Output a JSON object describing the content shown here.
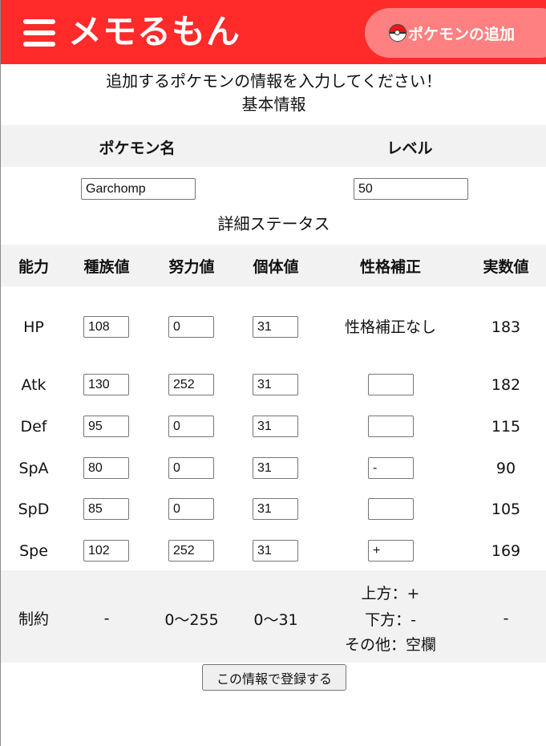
{
  "header": {
    "logo": "メモるもん",
    "add_button": "ポケモンの追加"
  },
  "intro": "追加するポケモンの情報を入力してください！",
  "basic_section": "基本情報",
  "basic": {
    "name_header": "ポケモン名",
    "level_header": "レベル",
    "name_value": "Garchomp",
    "level_value": "50"
  },
  "detail_section": "詳細ステータス",
  "stats_headers": [
    "能力",
    "種族値",
    "努力値",
    "個体値",
    "性格補正",
    "実数値"
  ],
  "stats": [
    {
      "label": "HP",
      "base": "108",
      "ev": "0",
      "iv": "31",
      "nature": "性格補正なし",
      "actual": "183"
    },
    {
      "label": "Atk",
      "base": "130",
      "ev": "252",
      "iv": "31",
      "nature": "",
      "actual": "182"
    },
    {
      "label": "Def",
      "base": "95",
      "ev": "0",
      "iv": "31",
      "nature": "",
      "actual": "115"
    },
    {
      "label": "SpA",
      "base": "80",
      "ev": "0",
      "iv": "31",
      "nature": "-",
      "actual": "90"
    },
    {
      "label": "SpD",
      "base": "85",
      "ev": "0",
      "iv": "31",
      "nature": "",
      "actual": "105"
    },
    {
      "label": "Spe",
      "base": "102",
      "ev": "252",
      "iv": "31",
      "nature": "+",
      "actual": "169"
    }
  ],
  "constraints": {
    "label": "制約",
    "base": "-",
    "ev": "0〜255",
    "iv": "0〜31",
    "nature_lines": [
      "上方：+",
      "下方：-",
      "その他：空欄"
    ],
    "actual": "-"
  },
  "submit_label": "この情報で登録する",
  "colors": {
    "header_red": "#ff2a2a",
    "pill": "#ff8080",
    "band": "#f2f2f2"
  }
}
